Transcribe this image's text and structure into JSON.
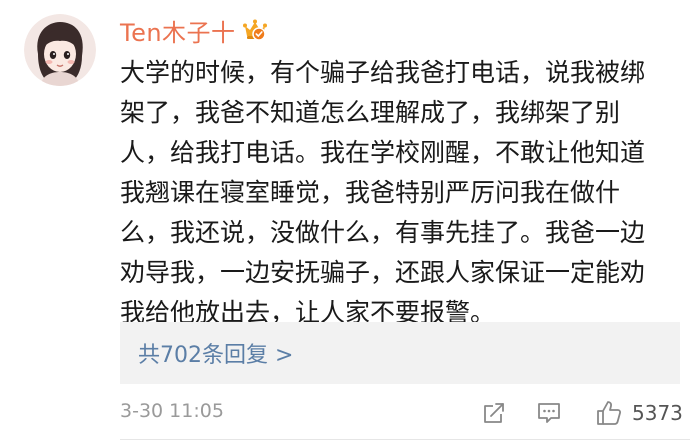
{
  "comment": {
    "username": "Ten木子十",
    "vip_badge_icon": "crown-vip-badge-icon",
    "avatar_icon": "user-avatar-illustration",
    "lines": [
      "大学的时候，有个骗子给我爸打电话，说我被绑",
      "架了，我爸不知道怎么理解成了，我绑架了别",
      "人，给我打电话。我在学校刚醒，不敢让他知道",
      "我翘课在寝室睡觉，我爸特别严厉问我在做什",
      "么，我还说，没做什么，有事先挂了。我爸一边",
      "劝导我，一边安抚骗子，还跟人家保证一定能劝",
      "我给他放出去，让人家不要报警。"
    ],
    "replies_link": "共702条回复 >",
    "timestamp": "3-30 11:05",
    "like_count": "5373"
  },
  "icons": {
    "share": "share-icon",
    "comment": "comment-icon",
    "like": "thumbs-up-icon"
  },
  "colors": {
    "username": "#eb7350",
    "link": "#5b7ea6",
    "meta": "#9a9a9a",
    "reply_bg": "#f2f2f2"
  }
}
